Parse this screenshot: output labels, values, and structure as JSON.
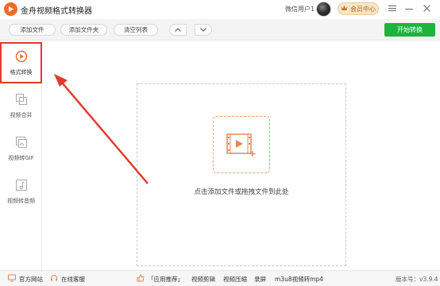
{
  "titlebar": {
    "app_title": "金舟视频格式转换器",
    "user_name": "微信用户1",
    "vip_label": "会员中心"
  },
  "toolbar": {
    "add_file": "添加文件",
    "add_folder": "添加文件夹",
    "clear_list": "清空列表",
    "start": "开始转换"
  },
  "sidebar": {
    "items": [
      {
        "label": "格式转换",
        "icon": "format-convert-icon",
        "active": true
      },
      {
        "label": "视频合并",
        "icon": "video-merge-icon",
        "active": false
      },
      {
        "label": "视频转GIF",
        "icon": "gif-icon",
        "active": false
      },
      {
        "label": "视频转音频",
        "icon": "audio-icon",
        "active": false
      }
    ]
  },
  "main": {
    "drop_text": "点击添加文件或拖拽文件到此处"
  },
  "statusbar": {
    "website": "官方网站",
    "service": "在线客服",
    "recommend": "「应用推荐」",
    "links": [
      "视频剪辑",
      "视频压缩",
      "录屏",
      "m3u8视频转mp4"
    ],
    "version": "版本号：v3.9.4"
  },
  "colors": {
    "accent_orange": "#f06a2a",
    "start_green": "#1db33c",
    "annotation_red": "#e23a2e"
  }
}
